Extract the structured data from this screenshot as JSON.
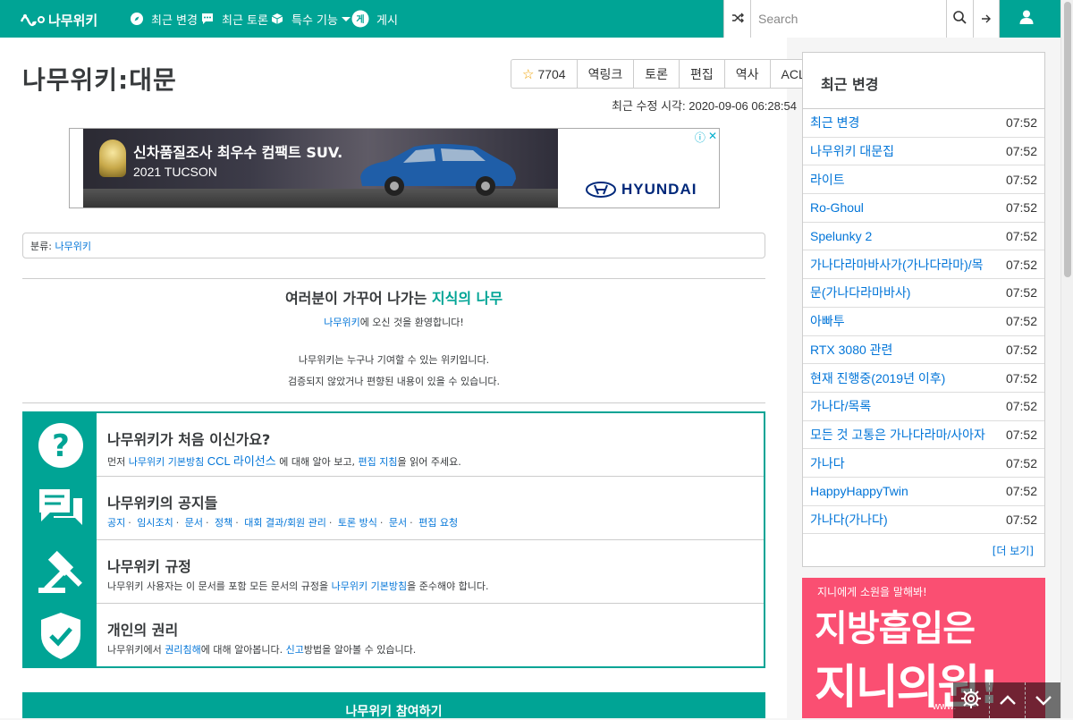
{
  "nav": {
    "logo_text": "나무위키",
    "items": [
      {
        "label": "최근 변경",
        "icon": "compass-icon"
      },
      {
        "label": "최근 토론",
        "icon": "comment-icon"
      },
      {
        "label": "특수 기능",
        "icon": "cube-icon"
      },
      {
        "label": "게시",
        "icon": "board-icon"
      }
    ],
    "search": {
      "placeholder": "Search",
      "value": ""
    }
  },
  "article": {
    "title": "나무위키:대문",
    "buttons": [
      {
        "label": "7704",
        "icon": "star-icon"
      },
      {
        "label": "역링크"
      },
      {
        "label": "토론"
      },
      {
        "label": "편집"
      },
      {
        "label": "역사"
      },
      {
        "label": "ACL"
      }
    ],
    "last_modified_label": "최근 수정 시각:",
    "last_modified": "2020-09-06 06:28:54",
    "category_label": "분류:",
    "category_link": "나무위키",
    "notice": {
      "title_prefix": "여러분이 가꾸어 나가는",
      "title_link": "지식의 나무",
      "line1_link": "나무위키",
      "line1": "에 오신 것을 환영합니다!",
      "line2": "나무위키는 누구나 기여할 수 있는 위키입니다.",
      "line3": "검증되지 않았거나 편향된 내용이 있을 수 있습니다."
    },
    "info": [
      {
        "title": "나무위키가 처음 이신가요?",
        "text_prefix": "먼저",
        "links": [
          "나무위키 기본방침",
          "CCL 라이선스",
          "편집 지침"
        ],
        "text_mid": "에 대해 알아 보고, ",
        "text_suffix": "을 읽어 주세요.",
        "icon": "question-icon"
      },
      {
        "title": "나무위키의 공지들",
        "links": [
          "공지",
          "임시조치",
          "문서",
          "정책",
          "대회 결과",
          "회원 관리",
          "토론 방식",
          "문서",
          "편집 요청"
        ],
        "icon": "discussion-icon"
      },
      {
        "title": "나무위키 규정",
        "text_prefix": "나무위키 사용자는 이 문서를 포함 모든 문서의 규정을",
        "link": "나무위키 기본방침",
        "text_suffix": "을 준수해야 합니다.",
        "icon": "gavel-icon"
      },
      {
        "title": "개인의 권리",
        "text_prefix": "나무위키에서",
        "link": "권리침해",
        "text_mid": "에 대해 알아봅니다.",
        "link2": "신고",
        "text_suffix": "방법을 알아볼 수 있습니다.",
        "icon": "shield-check-icon"
      }
    ],
    "footer_bar": "나무위키 참여하기"
  },
  "sidebar": {
    "title": "최근 변경",
    "items": [
      {
        "name": "최근 변경",
        "time": "07:52"
      },
      {
        "name": "나무위키 대문집",
        "time": "07:52"
      },
      {
        "name": "라이트",
        "time": "07:52"
      },
      {
        "name": "Ro-Ghoul",
        "time": "07:52"
      },
      {
        "name": "Spelunky 2",
        "time": "07:52"
      },
      {
        "name": "가나다라마바사가(가나다라마)/목",
        "time": "07:52"
      },
      {
        "name": "문(가나다라마바사)",
        "time": "07:52"
      },
      {
        "name": "아빠투",
        "time": "07:52"
      },
      {
        "name": "RTX 3080 관련",
        "time": "07:52"
      },
      {
        "name": "현재 진행중(2019년 이후)",
        "time": "07:52"
      },
      {
        "name": "가나다/목록",
        "time": "07:52"
      },
      {
        "name": "모든 것 고통은 가나다라마/사아자",
        "time": "07:52"
      },
      {
        "name": "가나다",
        "time": "07:52"
      },
      {
        "name": "HappyHappyTwin",
        "time": "07:52"
      },
      {
        "name": "가나다(가나다)",
        "time": "07:52"
      }
    ],
    "more": "[더 보기]"
  },
  "ads": {
    "top": {
      "headline": "신차품질조사 최우수 컴팩트 SUV.",
      "sub": "2021 TUCSON",
      "brand": "HYUNDAI"
    },
    "side": {
      "line1": "지니에게 소원을 말해봐!",
      "line2": "지방흡입은",
      "line3": "지니의원!",
      "url": "www."
    }
  },
  "colors": {
    "brand": "#00a495",
    "link": "#0275d8"
  }
}
